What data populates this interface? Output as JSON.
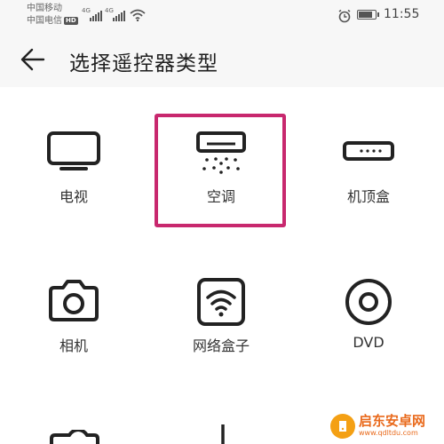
{
  "status_bar": {
    "carrier_1": "中国移动",
    "carrier_2": "中国电信",
    "hd_badge": "HD",
    "signal_1_network": "4G",
    "signal_2_network": "4G",
    "battery_level": 0.9,
    "time": "11:55"
  },
  "header": {
    "title": "选择遥控器类型",
    "back_icon": "arrow-left-icon"
  },
  "devices": [
    {
      "label": "电视",
      "icon": "tv-icon"
    },
    {
      "label": "空调",
      "icon": "air-conditioner-icon",
      "highlighted": true
    },
    {
      "label": "机顶盒",
      "icon": "set-top-box-icon"
    },
    {
      "label": "相机",
      "icon": "camera-icon"
    },
    {
      "label": "网络盒子",
      "icon": "network-box-icon"
    },
    {
      "label": "DVD",
      "icon": "dvd-icon"
    }
  ],
  "highlight_color": "#c8286e",
  "watermark": {
    "text": "启东安卓网",
    "url": "www.qdltdu.com"
  }
}
